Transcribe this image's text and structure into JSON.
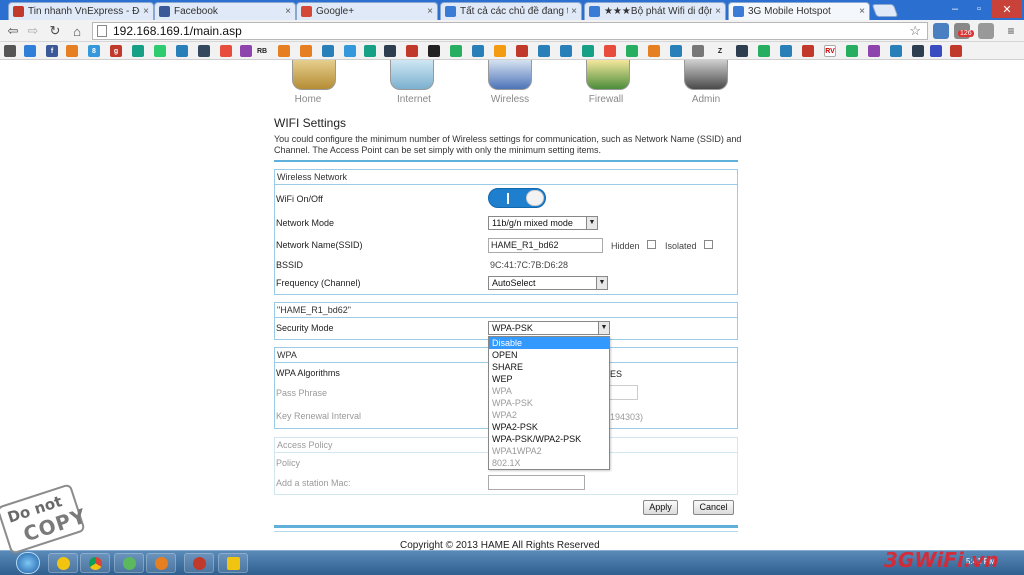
{
  "browser": {
    "tabs": [
      {
        "label": "Tin nhanh VnExpress - Đọ",
        "icon_color": "#c0392b"
      },
      {
        "label": "Facebook",
        "icon_color": "#3b5998"
      },
      {
        "label": "Google+",
        "icon_color": "#d34836"
      },
      {
        "label": "Tất cả các chủ đề đang th",
        "icon_color": "#3a7bd5"
      },
      {
        "label": "★★★Bộ phát Wifi di động",
        "icon_color": "#3a7bd5"
      },
      {
        "label": "3G Mobile Hotspot",
        "icon_color": "#3a7bd5",
        "active": true
      }
    ],
    "url": "192.168.169.1/main.asp",
    "notification_count": "126",
    "bookmark_icons": [
      "RB",
      "f",
      "8",
      "g",
      "f",
      "Z",
      "RV"
    ]
  },
  "router": {
    "nav": [
      {
        "label": "Home"
      },
      {
        "label": "Internet"
      },
      {
        "label": "Wireless"
      },
      {
        "label": "Firewall"
      },
      {
        "label": "Admin"
      }
    ],
    "page_title": "WIFI Settings",
    "description": "You could configure the minimum number of Wireless settings for communication, such as Network Name (SSID) and Channel. The Access Point can be set simply with only the minimum setting items.",
    "wireless_network": {
      "heading": "Wireless Network",
      "wifi_label": "WiFi On/Off",
      "wifi_toggle_state": "I",
      "mode_label": "Network Mode",
      "mode_value": "11b/g/n mixed mode",
      "ssid_label": "Network Name(SSID)",
      "ssid_value": "HAME_R1_bd62",
      "hidden_label": "Hidden",
      "isolated_label": "Isolated",
      "bssid_label": "BSSID",
      "bssid_value": "9C:41:7C:7B:D6:28",
      "channel_label": "Frequency (Channel)",
      "channel_value": "AutoSelect"
    },
    "security": {
      "heading": "\"HAME_R1_bd62\"",
      "mode_label": "Security Mode",
      "mode_value": "WPA-PSK",
      "options": [
        {
          "label": "Disable",
          "selected": true
        },
        {
          "label": "OPEN"
        },
        {
          "label": "SHARE"
        },
        {
          "label": "WEP"
        },
        {
          "label": "WPA",
          "dim": true
        },
        {
          "label": "WPA-PSK",
          "dim": true
        },
        {
          "label": "WPA2",
          "dim": true
        },
        {
          "label": "WPA2-PSK"
        },
        {
          "label": "WPA-PSK/WPA2-PSK"
        },
        {
          "label": "WPA1WPA2",
          "dim": true
        },
        {
          "label": "802.1X",
          "dim": true
        }
      ]
    },
    "wpa": {
      "heading": "WPA",
      "algorithms_label": "WPA Algorithms",
      "algorithms_tail": "ES",
      "passphrase_label": "Pass Phrase",
      "renewal_label": "Key Renewal Interval",
      "renewal_tail": "194303)"
    },
    "access_policy": {
      "heading": "Access Policy",
      "policy_label": "Policy",
      "add_mac_label": "Add a station Mac:"
    },
    "buttons": {
      "apply": "Apply",
      "cancel": "Cancel"
    },
    "copyright": "Copyright © 2013 HAME All Rights Reserved"
  },
  "taskbar": {
    "clock": "5:41 PM"
  },
  "watermark": {
    "stamp_line1": "Do not",
    "stamp_line2": "COPY",
    "site": "3GWiFi.vn"
  },
  "colors": {
    "accent_blue": "#5fb0da",
    "toggle_blue": "#1e7fcf",
    "selected_option": "#3399ff"
  }
}
